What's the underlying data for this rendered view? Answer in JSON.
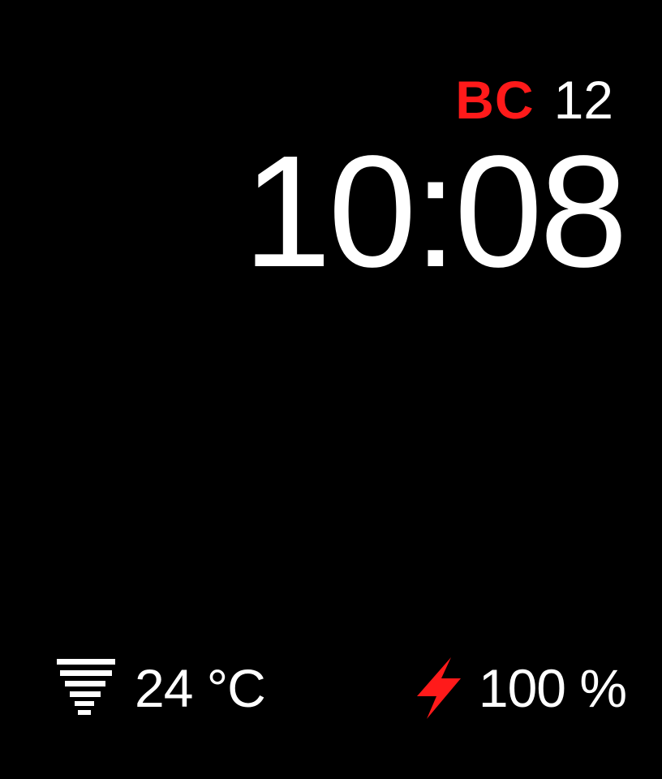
{
  "watch": {
    "date": {
      "abbr": "BC",
      "day": "12"
    },
    "time": "10:08",
    "weather": {
      "icon": "tornado-icon",
      "temperature": "24 °C"
    },
    "battery": {
      "icon": "lightning-bolt-icon",
      "level": "100 %"
    }
  },
  "colors": {
    "background": "#000000",
    "text": "#ffffff",
    "accent": "#ff1a1a"
  }
}
